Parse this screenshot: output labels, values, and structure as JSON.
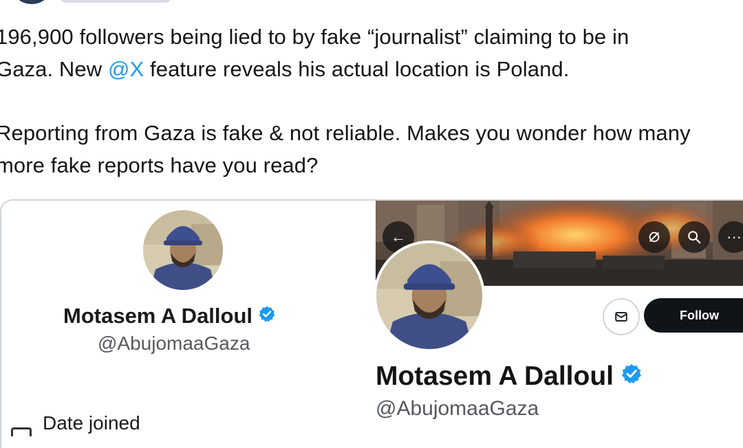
{
  "tweet": {
    "line1": "196,900 followers being lied to by fake “journalist” claiming to be in",
    "line2_pre": "Gaza. New ",
    "mention": "@X",
    "line2_post": " feature reveals his actual location is Poland.",
    "line3": "Reporting from Gaza is fake & not reliable. Makes you wonder how many",
    "line4": "more fake reports have you read?"
  },
  "left_profile": {
    "name": "Motasem A Dalloul",
    "handle": "@AbujomaaGaza",
    "joined_label": "Date joined"
  },
  "right_profile": {
    "name": "Motasem A Dalloul",
    "handle": "@AbujomaaGaza",
    "follow_label": "Follow"
  },
  "icons": {
    "back": "arrow-left-icon",
    "notifications": "bell-off-icon",
    "search": "search-icon",
    "more": "more-icon",
    "message": "mail-icon",
    "verified": "verified-badge-icon",
    "calendar": "calendar-icon"
  },
  "colors": {
    "mention": "#1d9bf0",
    "verified": "#1d9bf0",
    "follow_button": "#0f1419"
  }
}
